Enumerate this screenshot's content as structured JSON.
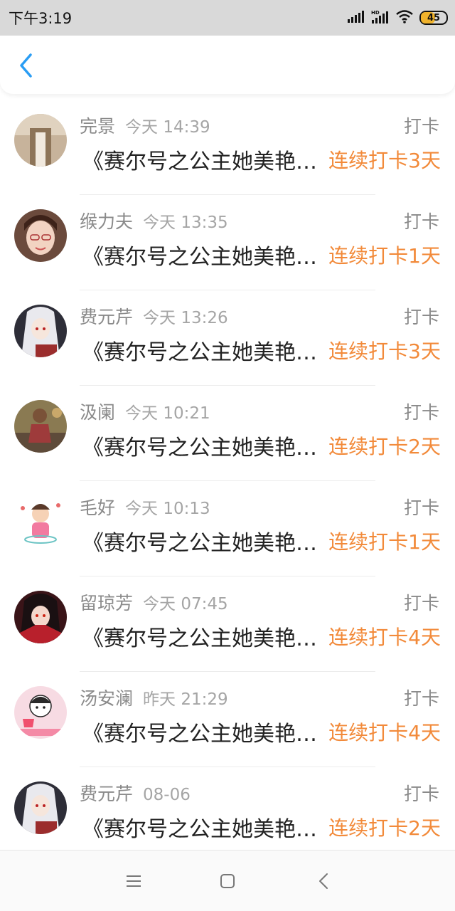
{
  "status_bar": {
    "time": "下午3:19",
    "battery": "45",
    "icons": [
      "signal-icon",
      "hd-signal-icon",
      "wifi-icon",
      "battery-icon"
    ]
  },
  "nav": {
    "back_icon": "chevron-left-icon",
    "accent_color": "#2a9df4"
  },
  "list": {
    "items": [
      {
        "name": "完景",
        "time": "今天 14:39",
        "action": "打卡",
        "title": "《赛尔号之公主她美艳…",
        "streak": "连续打卡3天"
      },
      {
        "name": "缑力夫",
        "time": "今天 13:35",
        "action": "打卡",
        "title": "《赛尔号之公主她美艳…",
        "streak": "连续打卡1天"
      },
      {
        "name": "费元芹",
        "time": "今天 13:26",
        "action": "打卡",
        "title": "《赛尔号之公主她美艳…",
        "streak": "连续打卡3天"
      },
      {
        "name": "汲阑",
        "time": "今天 10:21",
        "action": "打卡",
        "title": "《赛尔号之公主她美艳…",
        "streak": "连续打卡2天"
      },
      {
        "name": "毛好",
        "time": "今天 10:13",
        "action": "打卡",
        "title": "《赛尔号之公主她美艳…",
        "streak": "连续打卡1天"
      },
      {
        "name": "留琼芳",
        "time": "今天 07:45",
        "action": "打卡",
        "title": "《赛尔号之公主她美艳…",
        "streak": "连续打卡4天"
      },
      {
        "name": "汤安澜",
        "time": "昨天 21:29",
        "action": "打卡",
        "title": "《赛尔号之公主她美艳…",
        "streak": "连续打卡4天"
      },
      {
        "name": "费元芹",
        "time": "08-06",
        "action": "打卡",
        "title": "《赛尔号之公主她美艳…",
        "streak": "连续打卡2天"
      }
    ]
  },
  "streak_color": "#f28a3a",
  "bottom_nav": {
    "icons": [
      "menu-icon",
      "home-square-icon",
      "back-triangle-icon"
    ]
  }
}
